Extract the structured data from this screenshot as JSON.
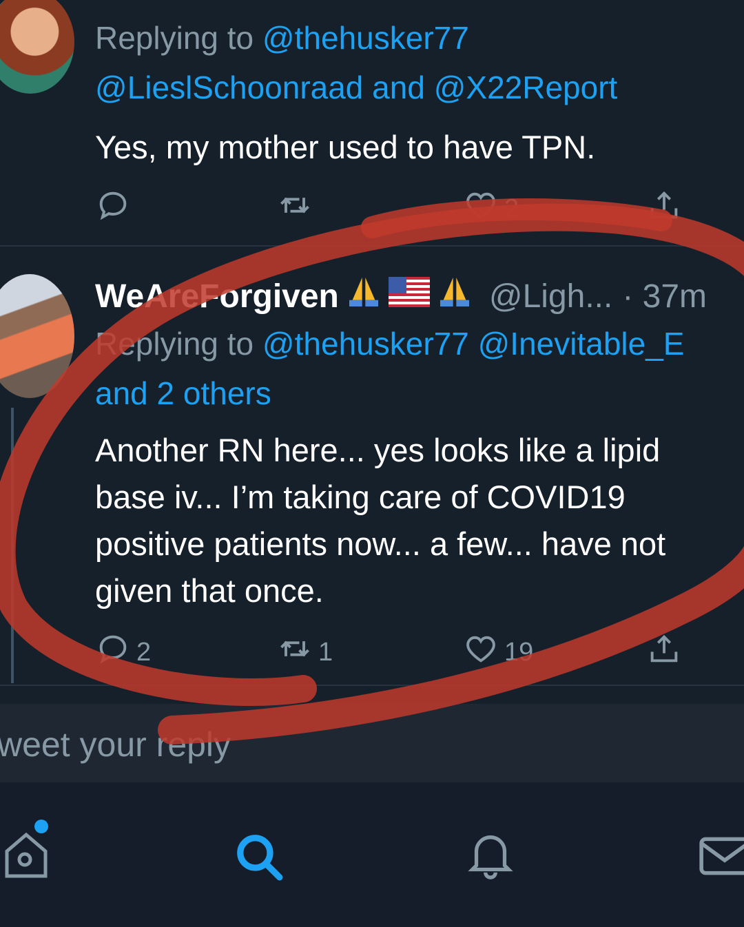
{
  "tweet1": {
    "replying_prefix": "Replying to",
    "mention1": "@thehusker77",
    "mention2": "@LieslSchoonraad",
    "and_word": "and",
    "mention3": "@X22Report",
    "text": "Yes, my mother used to have TPN.",
    "likes": "2"
  },
  "tweet2": {
    "name": "WeAreForgiven",
    "handle": "@Ligh...",
    "time": "· 37m",
    "replying_prefix": "Replying to",
    "mention1": "@thehusker77",
    "mention2": "@Inevitable_E",
    "others": "and 2 others",
    "text_lines": [
      "Another RN here... yes looks like a lipid",
      "base iv... I’m taking care of COVID19",
      "positive patients now... a few... have not",
      "given that once."
    ],
    "replies": "2",
    "retweets": "1",
    "likes": "19"
  },
  "reply_box": {
    "placeholder": "weet your reply"
  },
  "icons": {
    "reply": "reply-icon",
    "retweet": "retweet-icon",
    "like": "heart-icon",
    "share": "share-icon",
    "home": "home-icon",
    "search": "search-icon",
    "notifications": "bell-icon",
    "messages": "mail-icon"
  },
  "colors": {
    "background": "#15202b",
    "link": "#1da1f2",
    "muted": "#8899a6",
    "annotation": "#c0392b"
  }
}
